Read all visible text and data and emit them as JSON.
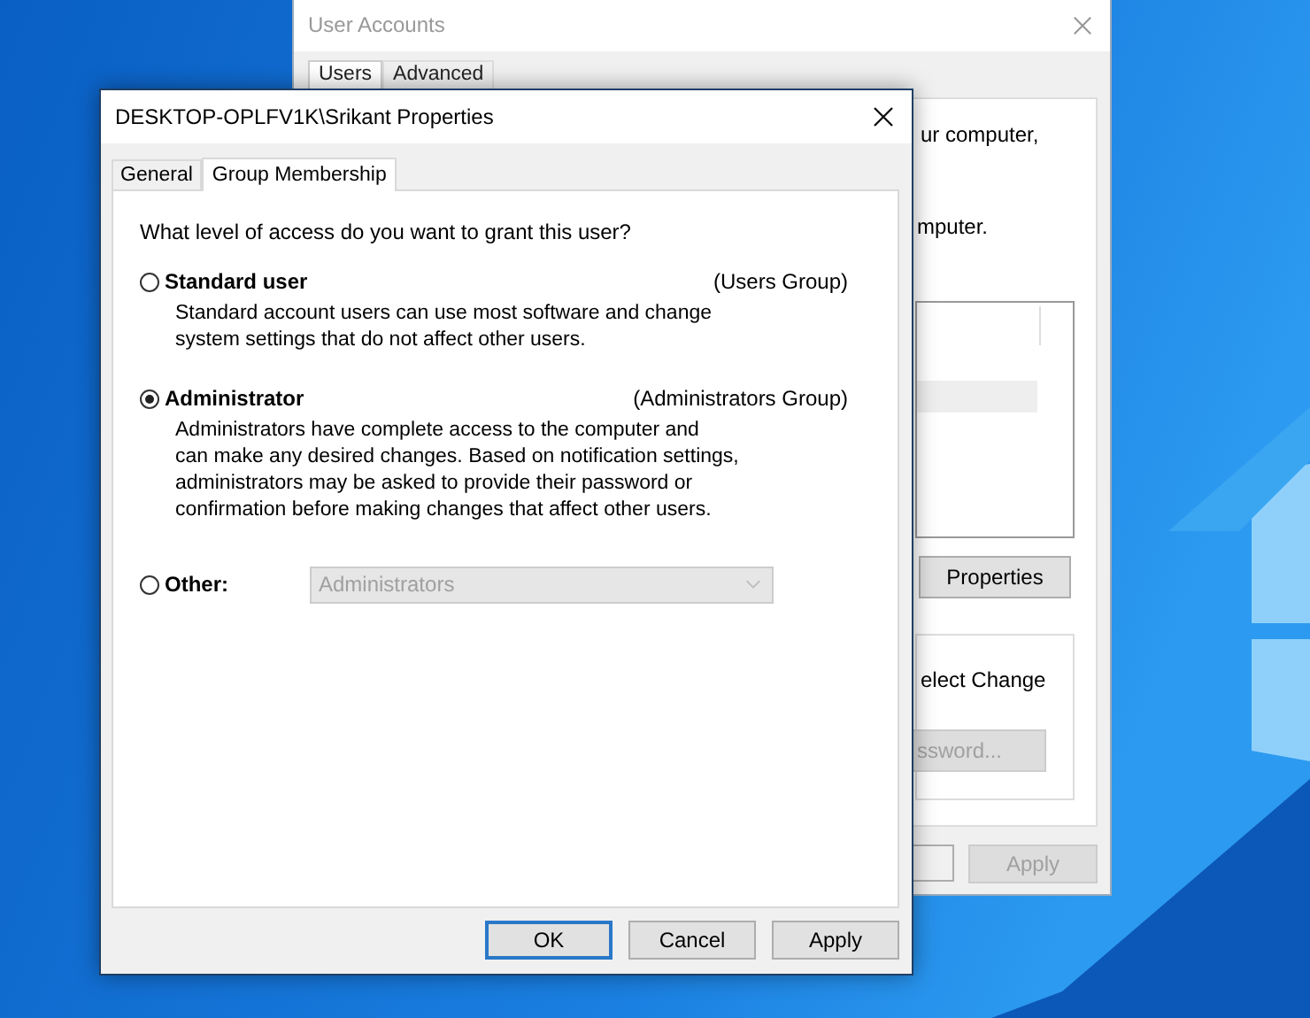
{
  "back_window": {
    "title": "User Accounts",
    "tabs": [
      {
        "label": "Users",
        "selected": true
      },
      {
        "label": "Advanced",
        "selected": false
      }
    ],
    "text_1": "ur computer,",
    "text_2": "mputer.",
    "properties_button": "Properties",
    "text_3": "elect Change",
    "password_button": {
      "label": "ssword...",
      "disabled": true
    },
    "apply_button": {
      "label": "Apply",
      "disabled": true
    }
  },
  "dialog": {
    "title": "DESKTOP-OPLFV1K\\Srikant Properties",
    "tabs": [
      {
        "label": "General",
        "selected": false
      },
      {
        "label": "Group Membership",
        "selected": true
      }
    ],
    "question": "What level of access do you want to grant this user?",
    "options": [
      {
        "kind": "group",
        "label": "Standard user",
        "group": "(Users Group)",
        "description": "Standard account users can use most software and change\nsystem settings that do not affect other users.",
        "selected": false
      },
      {
        "kind": "group",
        "label": "Administrator",
        "group": "(Administrators Group)",
        "description": "Administrators have complete access to the computer and\ncan make any desired changes. Based on notification settings,\nadministrators may be asked to provide their password or\nconfirmation before making changes that affect other users.",
        "selected": true
      },
      {
        "kind": "other",
        "label": "Other:",
        "dropdown": {
          "value": "Administrators",
          "disabled": true
        },
        "selected": false
      }
    ],
    "buttons": [
      {
        "label": "OK",
        "default": true
      },
      {
        "label": "Cancel",
        "default": false
      },
      {
        "label": "Apply",
        "default": false
      }
    ]
  }
}
